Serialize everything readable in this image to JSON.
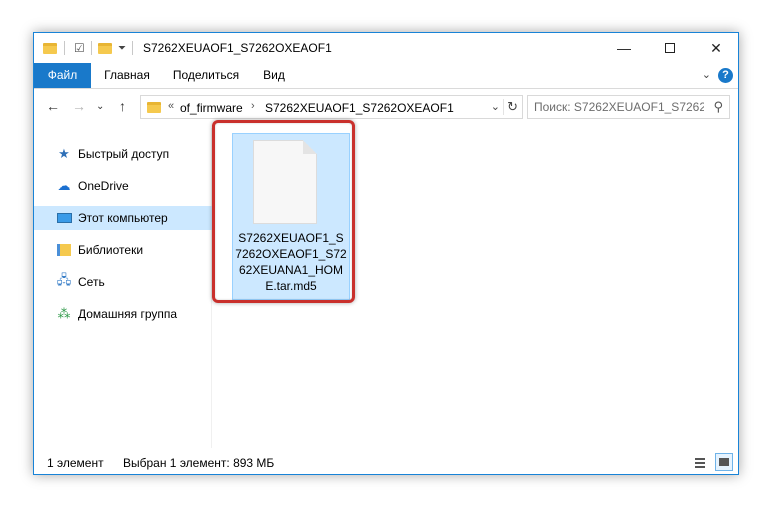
{
  "window": {
    "title": "S7262XEUAOF1_S7262OXEAOF1"
  },
  "ribbon": {
    "tabs": [
      "Файл",
      "Главная",
      "Поделиться",
      "Вид"
    ],
    "help": "?"
  },
  "navbar": {
    "overflow": "«",
    "breadcrumbs": [
      "of_firmware",
      "S7262XEUAOF1_S7262OXEAOF1"
    ],
    "search_placeholder": "Поиск: S7262XEUAOF1_S7262..."
  },
  "sidebar": {
    "items": [
      {
        "label": "Быстрый доступ",
        "icon": "star-icon"
      },
      {
        "label": "OneDrive",
        "icon": "cloud-icon"
      },
      {
        "label": "Этот компьютер",
        "icon": "computer-icon",
        "selected": true
      },
      {
        "label": "Библиотеки",
        "icon": "library-icon"
      },
      {
        "label": "Сеть",
        "icon": "network-icon"
      },
      {
        "label": "Домашняя группа",
        "icon": "homegroup-icon"
      }
    ]
  },
  "content": {
    "files": [
      {
        "name": "S7262XEUAOF1_S7262OXEAOF1_S7262XEUANA1_HOME.tar.md5",
        "selected": true
      }
    ]
  },
  "status": {
    "count": "1 элемент",
    "selection": "Выбран 1 элемент: 893 МБ"
  },
  "colors": {
    "accent": "#1979ca",
    "selection": "#cce8ff",
    "highlight_border": "#c9302c"
  }
}
